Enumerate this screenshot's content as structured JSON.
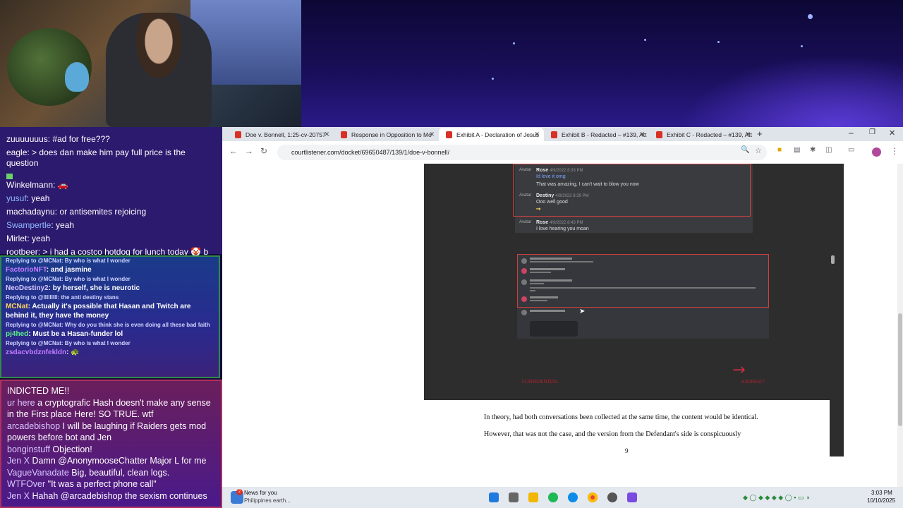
{
  "chat": {
    "top": [
      {
        "user": "zuuuuuuus",
        "text": " #ad for free???"
      },
      {
        "user": "eagle",
        "text": " > does dan make him pay full price is the question"
      },
      {
        "user": "Winkelmann",
        "text": ""
      },
      {
        "user": "yusuf",
        "text": " yeah"
      },
      {
        "user": "machadaynu",
        "text": " or antisemites rejoicing"
      },
      {
        "user": "Swampertle",
        "text": " yeah"
      },
      {
        "user": "Mirlet",
        "text": " yeah"
      },
      {
        "user": "rootbeer",
        "text": " > i had a costco hotdog for lunch today 🤡 b"
      }
    ],
    "mid": [
      {
        "reply": "Replying to @MCNat: By who is what I wonder",
        "user": "FactorioNFT",
        "text": " and jasmine"
      },
      {
        "reply": "Replying to @MCNat: By who is what I wonder",
        "user": "NeoDestiny2",
        "text": " by herself, she is neurotic"
      },
      {
        "reply": "Replying to @lllllllll: the anti destiny stans",
        "user": "MCNat",
        "text": " Actually it's possible that Hasan and Twitch are behind it, they have the money"
      },
      {
        "reply": "Replying to @MCNat: Why do you think she is even doing all these bad faith",
        "user": "pj4hed",
        "text": " Must be a Hasan-funder lol"
      },
      {
        "reply": "Replying to @MCNat: By who is what I wonder",
        "user": "zsdacvbdznfekldn",
        "text": " 🐢"
      }
    ],
    "bottom": [
      {
        "user": "",
        "text": "INDICTED ME!!"
      },
      {
        "user": "ur here",
        "text": " a cryptografic Hash doesn't make any sense in the First place Here! SO TRUE. wtf"
      },
      {
        "user": "arcadebishop",
        "text": "  I will be laughing if Raiders gets mod powers before bot and Jen"
      },
      {
        "user": "bonginstuff",
        "text": " Objection!"
      },
      {
        "user": "Jen X",
        "text": "  Damn @AnonymooseChatter Major L for me"
      },
      {
        "user": "VagueVanadate",
        "text": " Big, beautiful, clean logs."
      },
      {
        "user": "WTFOver",
        "text": " \"It was a perfect phone call\""
      },
      {
        "user": "Jen X",
        "text": "  Hahah @arcadebishop the sexism continues"
      }
    ]
  },
  "browser": {
    "tabs": [
      {
        "label": "Doe v. Bonnell, 1:25-cv-20757 -"
      },
      {
        "label": "Response in Opposition to Mo"
      },
      {
        "label": "Exhibit A - Declaration of Jesus"
      },
      {
        "label": "Exhibit B - Redacted – #139, Att"
      },
      {
        "label": "Exhibit C - Redacted – #139, Att"
      }
    ],
    "url": "courtlistener.com/docket/69650487/139/1/doe-v-bonnell/"
  },
  "pdf": {
    "card1": [
      {
        "name": "Rose",
        "time": "4/9/2022 8:33 PM",
        "text": "Id love it omg"
      },
      {
        "name": "",
        "time": "",
        "text": "That was amazing, I can't wait to blow you now"
      },
      {
        "name": "Destiny",
        "time": "4/9/2022 8:39 PM",
        "text": "Ooo well good"
      },
      {
        "name": "Rose",
        "time": "4/9/2022 8:43 PM",
        "text": "I love hearing you moan"
      }
    ],
    "avatar_label": "Avatar",
    "confidential": "CONFIDENTIAL",
    "bates": "S.B.001617",
    "para1": "In theory, had both conversations been collected at the same time, the content would be identical.",
    "para2": "However, that was not the case, and the version from the Defendant's side is conspicuously",
    "page_number": "9"
  },
  "taskbar": {
    "news_title": "News for you",
    "news_sub": "Philippines earth...",
    "news_badge": "2",
    "time": "3:03 PM",
    "date": "10/10/2025"
  }
}
